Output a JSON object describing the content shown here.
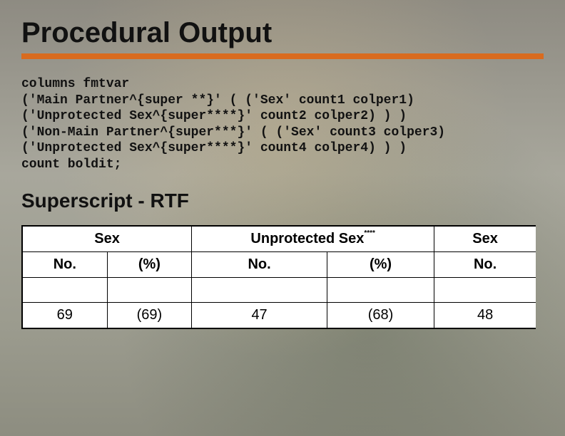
{
  "title": "Procedural Output",
  "code_lines": [
    "columns fmtvar",
    "('Main Partner^{super **}' ( ('Sex' count1 colper1)",
    "('Unprotected Sex^{super****}' count2 colper2) ) )",
    "('Non-Main Partner^{super***}' ( ('Sex' count3 colper3)",
    "('Unprotected Sex^{super****}' count4 colper4) ) )",
    "count boldit;"
  ],
  "subhead": "Superscript - RTF",
  "chart_data": {
    "type": "table",
    "header_row1": {
      "c1": "Sex",
      "c2": "Unprotected Sex",
      "c2_super": "****",
      "c3": "Sex"
    },
    "header_row2": {
      "c1": "No.",
      "c2": "(%)",
      "c3": "No.",
      "c4": "(%)",
      "c5": "No."
    },
    "data_row": {
      "c1": "69",
      "c2": "(69)",
      "c3": "47",
      "c4": "(68)",
      "c5": "48"
    }
  }
}
